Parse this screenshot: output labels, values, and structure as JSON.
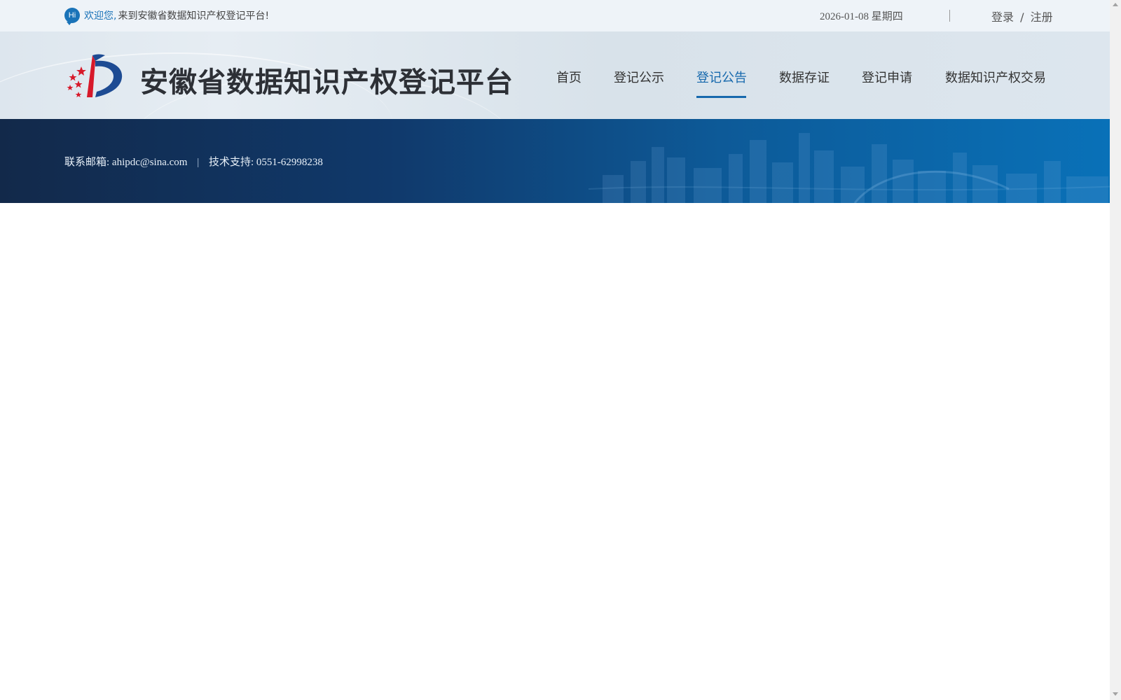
{
  "topbar": {
    "hi_icon": "Hi",
    "welcome_prefix": "欢迎您,",
    "welcome_text": "来到安徽省数据知识产权登记平台!",
    "date": "2026-01-08 星期四",
    "login": "登录",
    "auth_sep": "/",
    "register": "注册"
  },
  "header": {
    "site_title": "安徽省数据知识产权登记平台",
    "nav": [
      {
        "label": "首页",
        "active": false
      },
      {
        "label": "登记公示",
        "active": false
      },
      {
        "label": "登记公告",
        "active": true
      },
      {
        "label": "数据存证",
        "active": false
      },
      {
        "label": "登记申请",
        "active": false
      },
      {
        "label": "数据知识产权交易",
        "active": false
      }
    ]
  },
  "banner": {
    "email_label": "联系邮箱:",
    "email": "ahipdc@sina.com",
    "sep": "|",
    "support_label": "技术支持:",
    "phone": "0551-62998238"
  },
  "colors": {
    "accent": "#1769ad",
    "banner_dark": "#12294a",
    "banner_light": "#0971b8",
    "logo_red": "#d7192a"
  }
}
